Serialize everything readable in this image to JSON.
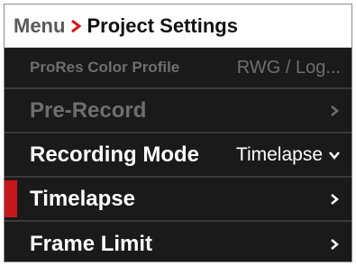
{
  "header": {
    "root": "Menu",
    "current": "Project Settings"
  },
  "rows": [
    {
      "label": "ProRes Color Profile",
      "value": "RWG / Log..."
    },
    {
      "label": "Pre-Record",
      "value": ""
    },
    {
      "label": "Recording Mode",
      "value": "Timelapse"
    },
    {
      "label": "Timelapse",
      "value": ""
    },
    {
      "label": "Frame Limit",
      "value": ""
    }
  ],
  "colors": {
    "accent": "#d4151c",
    "selected_marker": "#c8161d",
    "background": "#141414",
    "dim_text": "#6e6e6e"
  }
}
